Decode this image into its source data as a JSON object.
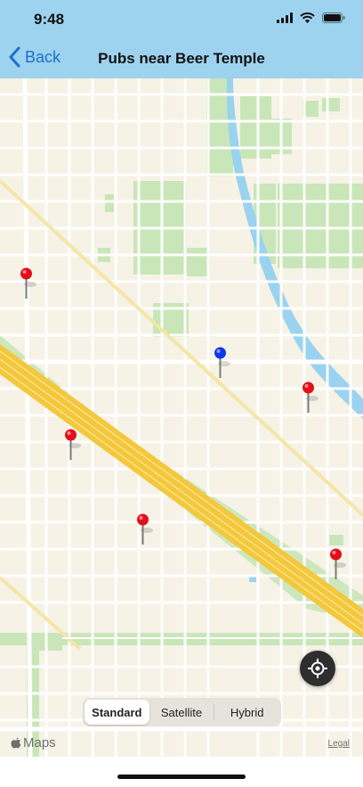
{
  "status_bar": {
    "time": "9:48"
  },
  "nav": {
    "back_label": "Back",
    "title": "Pubs near Beer Temple"
  },
  "map": {
    "pins": [
      {
        "color": "#e30f1b",
        "name": "pub-pin"
      },
      {
        "color": "#e30f1b",
        "name": "pub-pin"
      },
      {
        "color": "#e30f1b",
        "name": "pub-pin"
      },
      {
        "color": "#e30f1b",
        "name": "pub-pin"
      },
      {
        "color": "#e30f1b",
        "name": "pub-pin"
      },
      {
        "color": "#1036e8",
        "name": "current-location-pin"
      }
    ],
    "map_types": [
      "Standard",
      "Satellite",
      "Hybrid"
    ],
    "selected_type": "Standard",
    "attribution": "Maps",
    "legal": "Legal"
  },
  "colors": {
    "nav_background": "#9dd3ee",
    "accent": "#1f6fd1",
    "map_land": "#f6f2e6",
    "park": "#c9e6b8",
    "water": "#9ad3f0",
    "highway": "#f4c83c",
    "red_pin": "#e30f1b",
    "blue_pin": "#1036e8"
  }
}
